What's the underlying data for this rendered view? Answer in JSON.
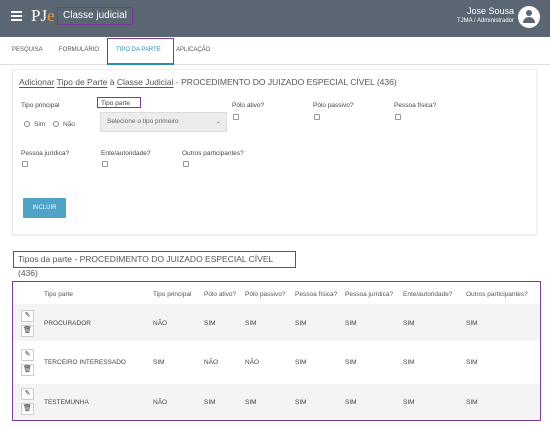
{
  "header": {
    "logo": "PJe",
    "app_title": "Classe judicial",
    "user_name": "Jose Sousa",
    "user_role": "TJMA / Administrador"
  },
  "tabs": [
    {
      "label": "PESQUISA"
    },
    {
      "label": "FORMULÁRIO"
    },
    {
      "label": "TIPO DA PARTE",
      "active": true
    },
    {
      "label": "APLICAÇÃO"
    }
  ],
  "form": {
    "title_parts": [
      "Adicionar",
      "Tipo de Parte",
      "à",
      "Classe Judicial",
      "- PROCEDIMENTO DO JUIZADO ESPECIAL CÍVEL (436)"
    ],
    "tipo_principal_label": "Tipo principal",
    "radio_sim": "Sim",
    "radio_nao": "Não",
    "tipo_parte_label": "Tipo parte",
    "select_placeholder": "Selecione o tipo primeiro",
    "polo_ativo_label": "Pólo ativo?",
    "polo_passivo_label": "Pólo passivo?",
    "pessoa_fisica_label": "Pessoa física?",
    "pessoa_juridica_label": "Pessoa jurídica?",
    "ente_autoridade_label": "Ente/autoridade?",
    "outros_participantes_label": "Outros participantes?",
    "incluir_button": "INCLUIR"
  },
  "list": {
    "title": "Tipos da parte - PROCEDIMENTO DO JUIZADO ESPECIAL CÍVEL (436)",
    "columns": [
      "Tipo parte",
      "Tipo principal",
      "Pólo ativo?",
      "Pólo passivo?",
      "Pessoa física?",
      "Pessoa jurídica?",
      "Ente/autoridade?",
      "Outros participantes?"
    ],
    "rows": [
      [
        "PROCURADOR",
        "NÃO",
        "SIM",
        "SIM",
        "SIM",
        "SIM",
        "SIM",
        "SIM"
      ],
      [
        "TERCEIRO INTERESSADO",
        "SIM",
        "NÃO",
        "NÃO",
        "SIM",
        "SIM",
        "SIM",
        "SIM"
      ],
      [
        "TESTEMUNHA",
        "NÃO",
        "SIM",
        "SIM",
        "SIM",
        "SIM",
        "SIM",
        "SIM"
      ]
    ]
  },
  "icons": {
    "edit": "pencil-icon",
    "delete": "trash-icon",
    "menu": "hamburger-icon",
    "user": "user-avatar-icon"
  },
  "colors": {
    "topbar": "#5a6672",
    "accent": "#2b8fb3",
    "button": "#4fa3c7",
    "annotation": "#7a3a9a"
  }
}
